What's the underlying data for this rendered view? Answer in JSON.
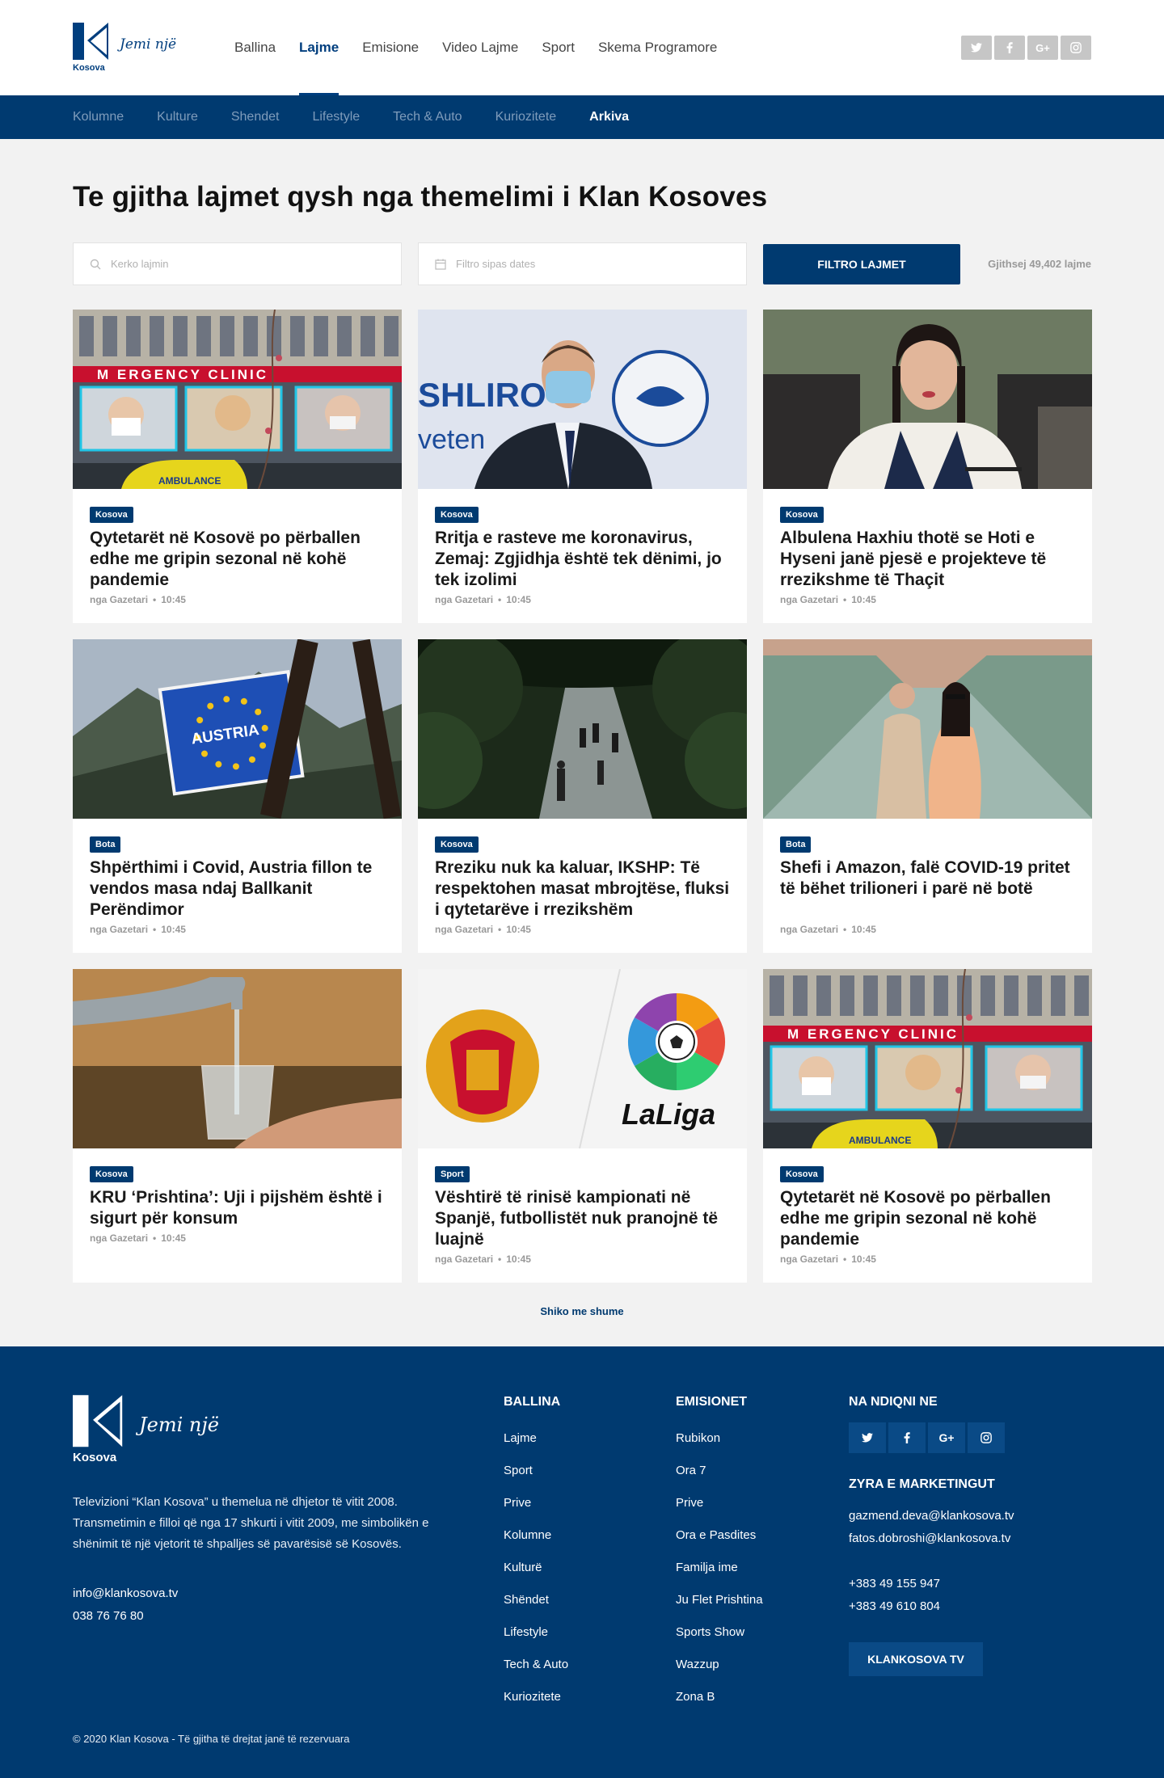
{
  "header": {
    "logo_word": "Kosova",
    "logo_slogan": "Jemi një",
    "nav": [
      {
        "label": "Ballina",
        "active": false
      },
      {
        "label": "Lajme",
        "active": true
      },
      {
        "label": "Emisione",
        "active": false
      },
      {
        "label": "Video Lajme",
        "active": false
      },
      {
        "label": "Sport",
        "active": false
      },
      {
        "label": "Skema Programore",
        "active": false
      }
    ],
    "social": [
      "twitter-icon",
      "facebook-icon",
      "google-plus-icon",
      "instagram-icon"
    ]
  },
  "subnav": [
    {
      "label": "Kolumne",
      "active": false
    },
    {
      "label": "Kulture",
      "active": false
    },
    {
      "label": "Shendet",
      "active": false
    },
    {
      "label": "Lifestyle",
      "active": false
    },
    {
      "label": "Tech & Auto",
      "active": false
    },
    {
      "label": "Kuriozitete",
      "active": false
    },
    {
      "label": "Arkiva",
      "active": true
    }
  ],
  "page": {
    "title": "Te gjitha lajmet qysh nga themelimi i Klan Kosoves",
    "search_placeholder": "Kerko lajmin",
    "date_placeholder": "Filtro sipas dates",
    "filter_button": "FILTRO LAJMET",
    "total": "Gjithsej 49,402 lajme",
    "more": "Shiko me shume"
  },
  "articles": [
    {
      "category": "Kosova",
      "title": "Qytetarët në Kosovë po përballen edhe me gripin sezonal në kohë pandemie",
      "author": "nga Gazetari",
      "time": "10:45",
      "image": "clinic"
    },
    {
      "category": "Kosova",
      "title": "Rritja e rasteve me koronavirus, Zemaj: Zgjidhja është tek dënimi, jo tek izolimi",
      "author": "nga Gazetari",
      "time": "10:45",
      "image": "minister"
    },
    {
      "category": "Kosova",
      "title": "Albulena Haxhiu thotë se Hoti e Hyseni janë pjesë e projekteve të rrezikshme të Thaçit",
      "author": "nga Gazetari",
      "time": "10:45",
      "image": "woman"
    },
    {
      "category": "Bota",
      "title": "Shpërthimi i Covid, Austria fillon te vendos masa ndaj Ballkanit Perëndimor",
      "author": "nga Gazetari",
      "time": "10:45",
      "image": "austria"
    },
    {
      "category": "Kosova",
      "title": "Rreziku nuk ka kaluar, IKSHP: Të respektohen masat mbrojtëse, fluksi i qytetarëve i rrezikshëm",
      "author": "nga Gazetari",
      "time": "10:45",
      "image": "park"
    },
    {
      "category": "Bota",
      "title": "Shefi i Amazon, falë COVID-19 pritet të bëhet trilioneri i parë në botë",
      "author": "nga Gazetari",
      "time": "10:45",
      "image": "couple"
    },
    {
      "category": "Kosova",
      "title": "KRU ‘Prishtina’: Uji i pijshëm është i sigurt për konsum",
      "author": "nga Gazetari",
      "time": "10:45",
      "image": "water"
    },
    {
      "category": "Sport",
      "title": "Vështirë të rinisë kampionati në Spanjë, futbollistët nuk pranojnë të luajnë",
      "author": "nga Gazetari",
      "time": "10:45",
      "image": "laliga"
    },
    {
      "category": "Kosova",
      "title": "Qytetarët në Kosovë po përballen edhe me gripin sezonal në kohë pandemie",
      "author": "nga Gazetari",
      "time": "10:45",
      "image": "clinic"
    }
  ],
  "image_text": {
    "clinic": "M  ERGENCY CLINIC",
    "ambulance": "AMBULANCE",
    "minister_sign": "SHLIRO",
    "minister_sign2": "veten",
    "austria": "AUSTRIA",
    "laliga": "LaLiga"
  },
  "footer": {
    "slogan": "Jemi një",
    "logo_word": "Kosova",
    "about": "Televizioni “Klan Kosova” u themelua në dhjetor të vitit 2008. Transmetimin e filloi që nga 17 shkurti i vitit 2009, me simbolikën e shënimit të një vjetorit të shpalljes së pavarësisë së Kosovës.",
    "email": "info@klankosova.tv",
    "phone": "038 76 76 80",
    "col1_title": "BALLINA",
    "col1": [
      "Lajme",
      "Sport",
      "Prive",
      "Kolumne",
      "Kulturë",
      "Shëndet",
      "Lifestyle",
      "Tech & Auto",
      "Kuriozitete"
    ],
    "col2_title": "EMISIONET",
    "col2": [
      "Rubikon",
      "Ora 7",
      "Prive",
      "Ora e Pasdites",
      "Familja ime",
      "Ju Flet Prishtina",
      "Sports Show",
      "Wazzup",
      "Zona B"
    ],
    "follow_title": "NA NDIQNI NE",
    "marketing_title": "ZYRA E MARKETINGUT",
    "marketing_emails": [
      "gazmend.deva@klankosova.tv",
      "fatos.dobroshi@klankosova.tv"
    ],
    "marketing_phones": [
      "+383 49 155 947",
      "+383 49 610 804"
    ],
    "tv_button": "KLANKOSOVA TV",
    "copyright": "© 2020 Klan Kosova - Të gjitha të drejtat janë të rezervuara"
  },
  "colors": {
    "brand": "#003a70",
    "background": "#f2f2f2"
  }
}
